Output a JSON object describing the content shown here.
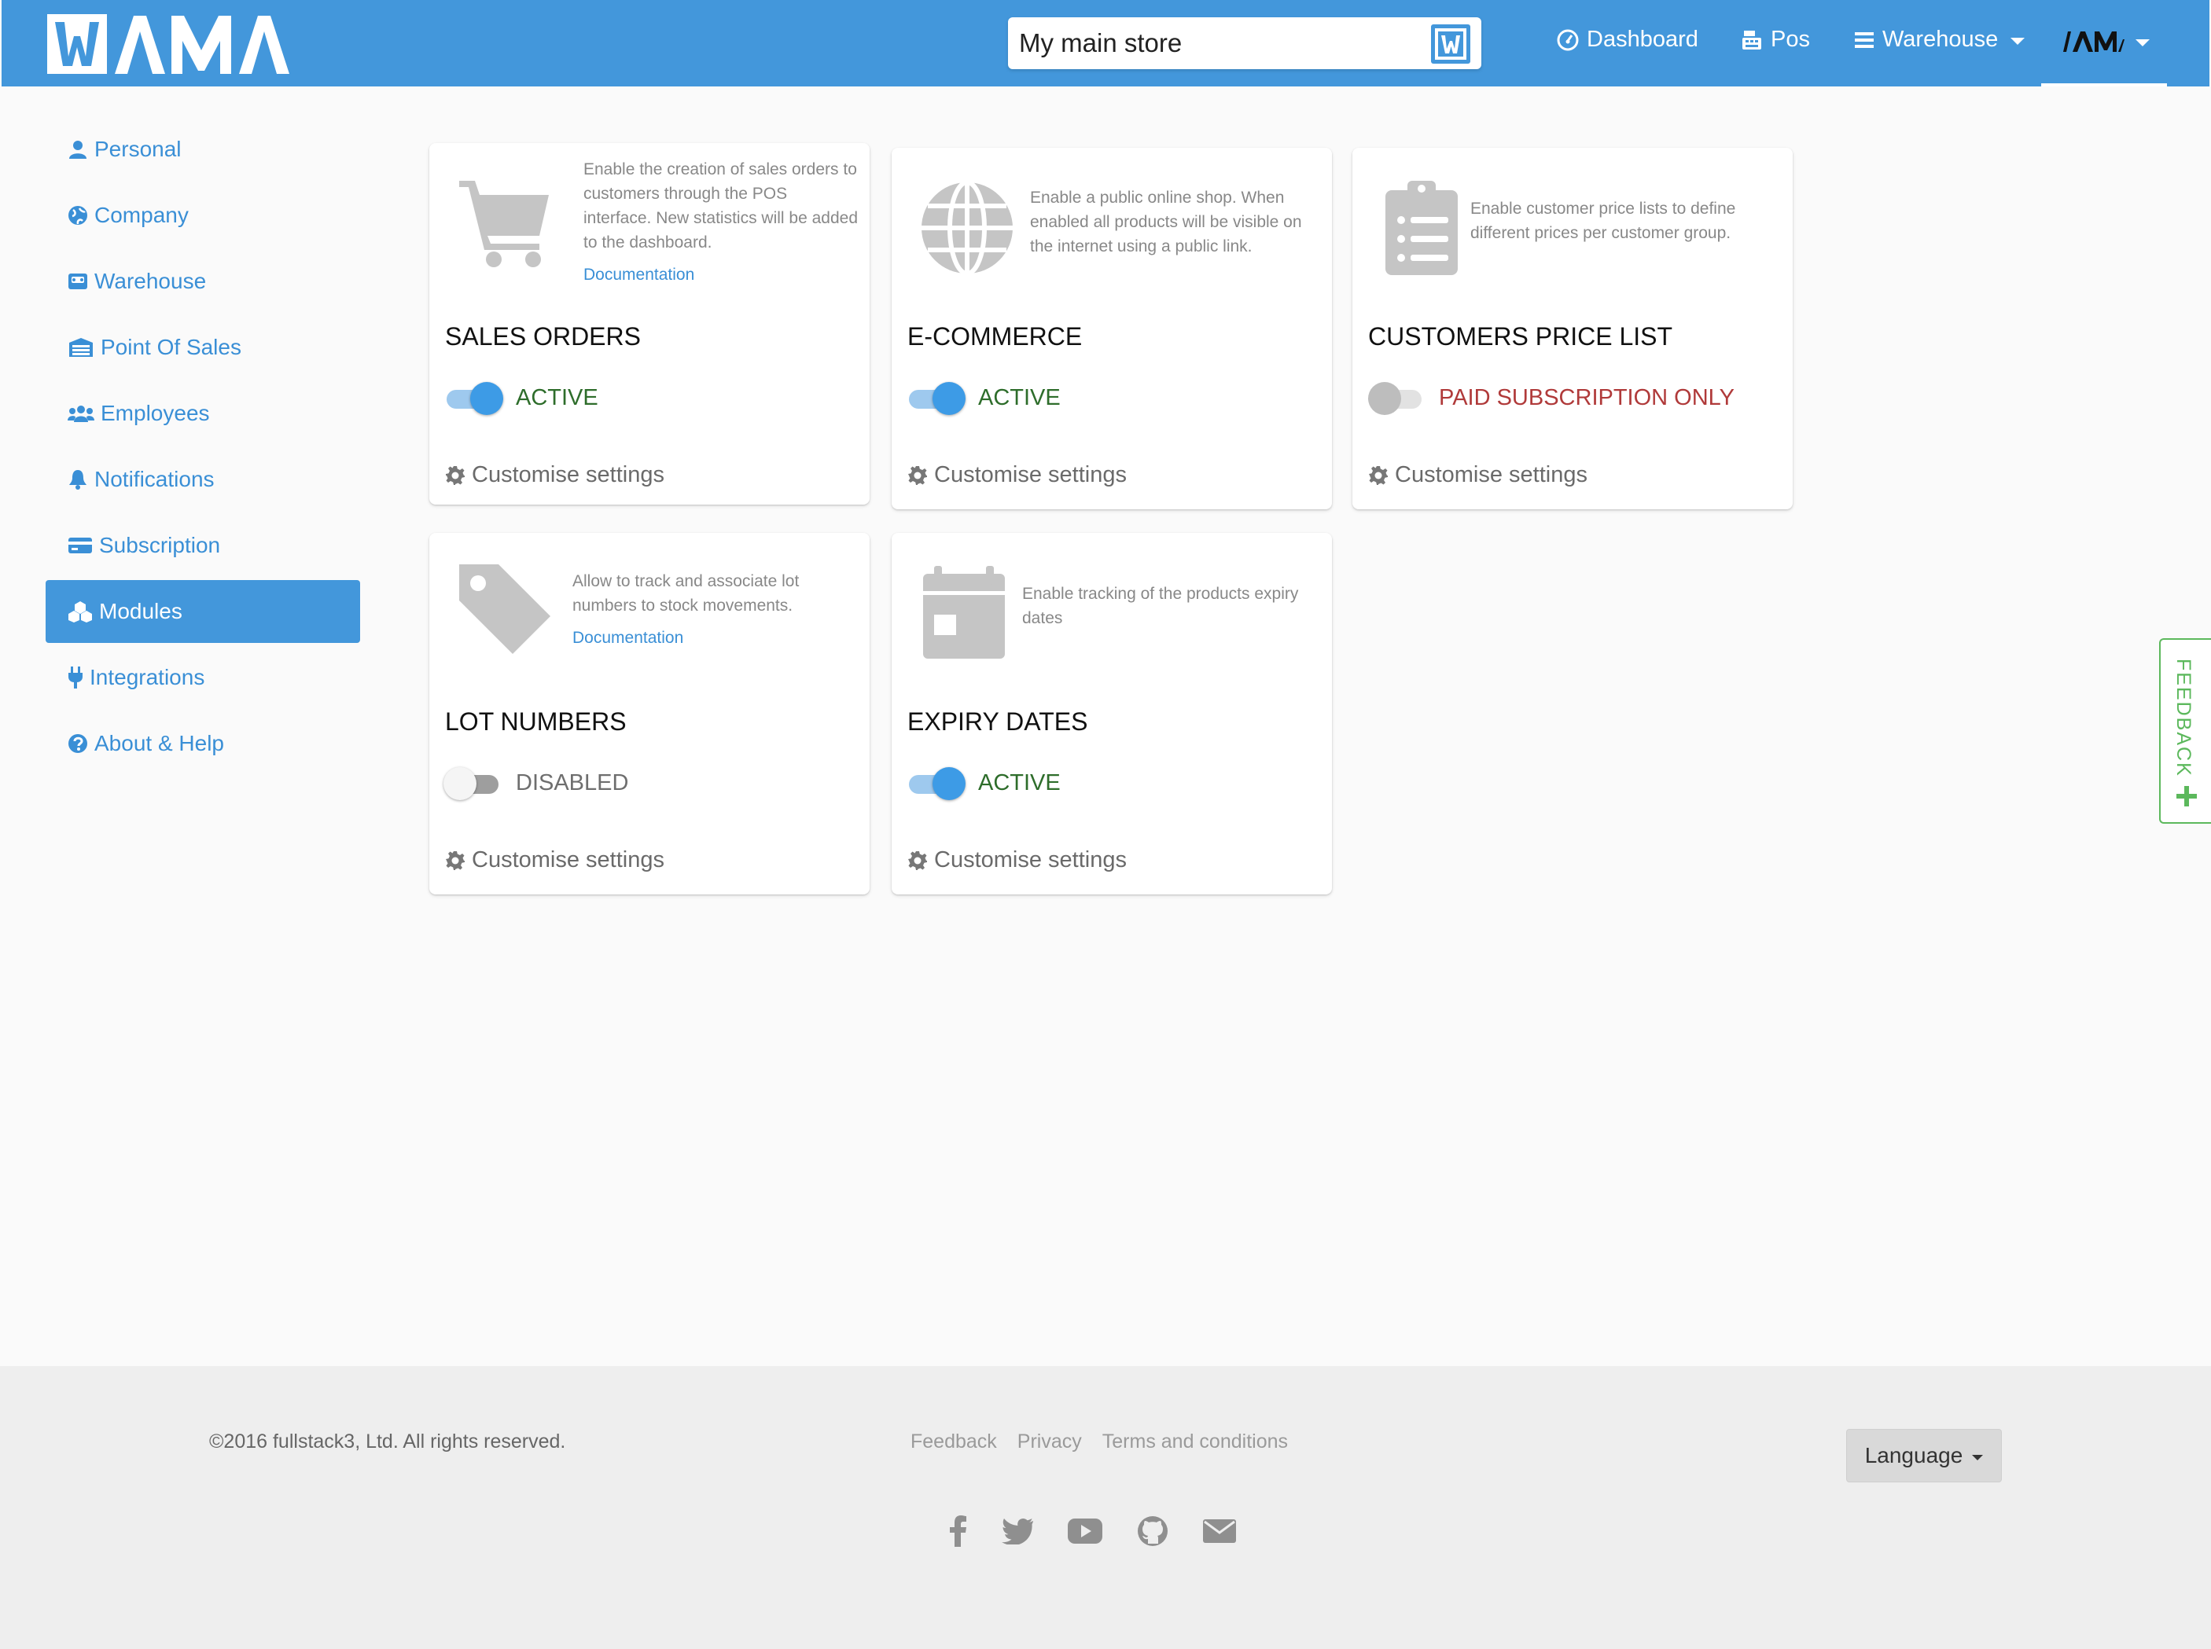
{
  "header": {
    "logo_text": "WAMA",
    "store_select": {
      "value": "My main store",
      "badge": "W"
    },
    "nav": [
      {
        "label": "Dashboard",
        "icon": "dashboard-icon"
      },
      {
        "label": "Pos",
        "icon": "cash-register-icon"
      },
      {
        "label": "Warehouse",
        "icon": "list-icon"
      }
    ],
    "user_menu": {
      "label": "WAMA",
      "icon": "user-logo-icon"
    }
  },
  "sidebar": {
    "items": [
      {
        "label": "Personal",
        "icon": "user-icon",
        "active": false
      },
      {
        "label": "Company",
        "icon": "globe-icon",
        "active": false
      },
      {
        "label": "Warehouse",
        "icon": "warehouse-icon",
        "active": false
      },
      {
        "label": "Point Of Sales",
        "icon": "cash-register-icon",
        "active": false
      },
      {
        "label": "Employees",
        "icon": "users-icon",
        "active": false
      },
      {
        "label": "Notifications",
        "icon": "bell-icon",
        "active": false
      },
      {
        "label": "Subscription",
        "icon": "credit-card-icon",
        "active": false
      },
      {
        "label": "Modules",
        "icon": "cubes-icon",
        "active": true
      },
      {
        "label": "Integrations",
        "icon": "plug-icon",
        "active": false
      },
      {
        "label": "About & Help",
        "icon": "question-icon",
        "active": false
      }
    ]
  },
  "modules": [
    {
      "title": "SALES ORDERS",
      "icon": "shopping-cart-icon",
      "description": "Enable the creation of sales orders to customers through the POS interface. New statistics will be added to the dashboard.",
      "doc_link": "Documentation",
      "state": "on",
      "status": "ACTIVE",
      "settings_label": "Customise settings"
    },
    {
      "title": "E-COMMERCE",
      "icon": "globe-icon",
      "description": "Enable a public online shop. When enabled all products will be visible on the internet using a public link.",
      "doc_link": "",
      "state": "on",
      "status": "ACTIVE",
      "settings_label": "Customise settings"
    },
    {
      "title": "CUSTOMERS PRICE LIST",
      "icon": "clipboard-list-icon",
      "description": "Enable customer price lists to define different prices per customer group.",
      "doc_link": "",
      "state": "locked",
      "status": "PAID SUBSCRIPTION ONLY",
      "settings_label": "Customise settings"
    },
    {
      "title": "LOT NUMBERS",
      "icon": "tag-icon",
      "description": "Allow to track and associate lot numbers to stock movements.",
      "doc_link": "Documentation",
      "state": "off",
      "status": "DISABLED",
      "settings_label": "Customise settings"
    },
    {
      "title": "EXPIRY DATES",
      "icon": "calendar-icon",
      "description": "Enable tracking of the products expiry dates",
      "doc_link": "",
      "state": "on",
      "status": "ACTIVE",
      "settings_label": "Customise settings"
    }
  ],
  "feedback_tab": {
    "label": "FEEDBACK"
  },
  "footer": {
    "copyright": "©2016 fullstack3, Ltd. All rights reserved.",
    "links": [
      "Feedback",
      "Privacy",
      "Terms and conditions"
    ],
    "language_button": "Language",
    "social": [
      "facebook-icon",
      "twitter-icon",
      "youtube-icon",
      "github-icon",
      "envelope-icon"
    ]
  },
  "colors": {
    "primary": "#4397db",
    "link": "#3a8fd6",
    "active_status": "#2e6d2b",
    "paid_status": "#b03a3a",
    "feedback": "#5cb85c"
  }
}
